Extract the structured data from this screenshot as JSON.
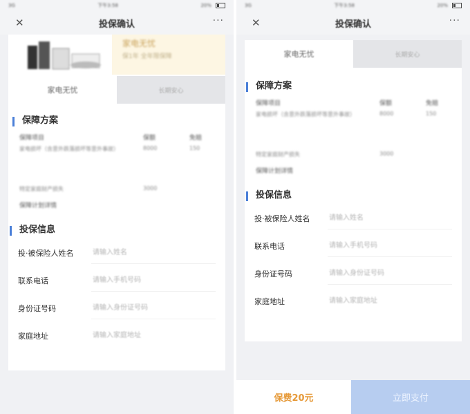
{
  "status_bar": {
    "carrier": "3G",
    "time": "下午3:58",
    "battery": "20%"
  },
  "navbar": {
    "title": "投保确认",
    "close_glyph": "✕",
    "more_glyph": "···"
  },
  "product": {
    "name": "家电无忧",
    "subtitle": "保1年   全年限保障"
  },
  "tabs": [
    {
      "label": "家电无忧",
      "active": true
    },
    {
      "label": "长期安心",
      "active": false
    }
  ],
  "plan": {
    "title": "保障方案",
    "headers": {
      "item": "保障项目",
      "amount": "保额",
      "deductible": "免赔"
    },
    "rows": [
      {
        "item": "家电损坏（含意外跌落损坏等意外事故）",
        "amount": "8000",
        "deductible": "150"
      },
      {
        "item": "特定家庭财产损失",
        "amount": "3000",
        "deductible": ""
      }
    ],
    "detail_link": "保障计划详情"
  },
  "info": {
    "title": "投保信息",
    "fields": [
      {
        "label": "投·被保险人姓名",
        "placeholder": "请输入姓名"
      },
      {
        "label": "联系电话",
        "placeholder": "请输入手机号码"
      },
      {
        "label": "身份证号码",
        "placeholder": "请输入身份证号码"
      },
      {
        "label": "家庭地址",
        "placeholder": "请输入家庭地址"
      }
    ]
  },
  "payment": {
    "fee": "保费20元",
    "pay_button": "立即支付"
  },
  "colors": {
    "accent": "#4a7fd8",
    "fee": "#e69a3a",
    "pay_button_bg": "#b7cdf0",
    "product_banner": "#fdf6e3"
  }
}
